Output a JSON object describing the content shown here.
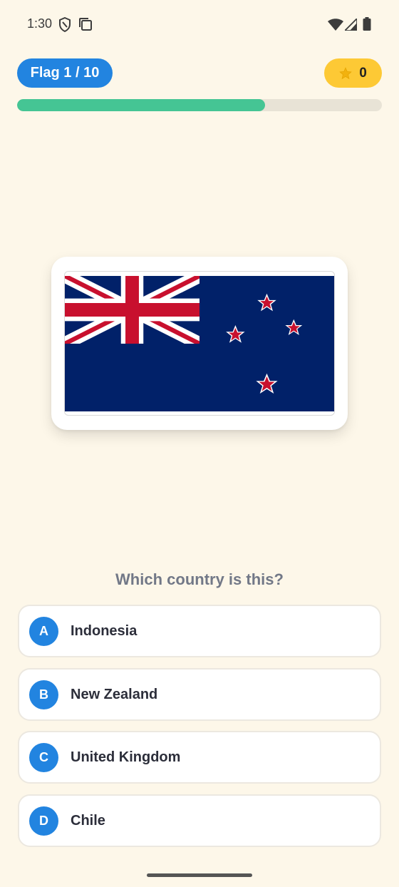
{
  "status_bar": {
    "time": "1:30",
    "icons": [
      "shield-icon",
      "cards-icon",
      "wifi-icon",
      "signal-icon",
      "battery-icon"
    ]
  },
  "header": {
    "flag_counter": "Flag 1 / 10",
    "score": "0",
    "score_icon": "star-icon"
  },
  "progress": {
    "fraction": 0.68,
    "fill_color": "#45c594",
    "track_color": "#e8e3d6"
  },
  "flag": {
    "icon": "new-zealand-flag",
    "colors": {
      "blue": "#012169",
      "red": "#c8102e",
      "white": "#ffffff"
    }
  },
  "question": "Which country is this?",
  "options": [
    {
      "letter": "A",
      "label": "Indonesia"
    },
    {
      "letter": "B",
      "label": "New Zealand"
    },
    {
      "letter": "C",
      "label": "United Kingdom"
    },
    {
      "letter": "D",
      "label": "Chile"
    }
  ],
  "colors": {
    "background": "#fdf7e9",
    "accent": "#2284e0",
    "score_badge": "#fdc935"
  }
}
